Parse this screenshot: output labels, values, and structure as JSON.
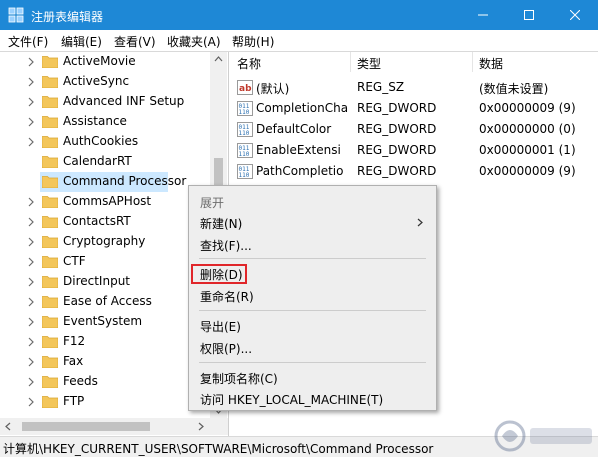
{
  "window": {
    "title": "注册表编辑器"
  },
  "menu": [
    "文件(F)",
    "编辑(E)",
    "查看(V)",
    "收藏夹(A)",
    "帮助(H)"
  ],
  "tree": {
    "selected": "Command Processor",
    "items": [
      "ActiveMovie",
      "ActiveSync",
      "Advanced INF Setup",
      "Assistance",
      "AuthCookies",
      "CalendarRT",
      "Command Processor",
      "CommsAPHost",
      "ContactsRT",
      "Cryptography",
      "CTF",
      "DirectInput",
      "Ease of Access",
      "EventSystem",
      "F12",
      "Fax",
      "Feeds",
      "FTP"
    ]
  },
  "list": {
    "headers": [
      "名称",
      "类型",
      "数据"
    ],
    "rows": [
      {
        "icon": "string-value-icon",
        "name": "(默认)",
        "type": "REG_SZ",
        "data": "(数值未设置)"
      },
      {
        "icon": "binary-value-icon",
        "name": "CompletionChar",
        "type": "REG_DWORD",
        "data": "0x00000009 (9)"
      },
      {
        "icon": "binary-value-icon",
        "name": "DefaultColor",
        "type": "REG_DWORD",
        "data": "0x00000000 (0)"
      },
      {
        "icon": "binary-value-icon",
        "name": "EnableExtensi",
        "type": "REG_DWORD",
        "data": "0x00000001 (1)"
      },
      {
        "icon": "binary-value-icon",
        "name": "PathCompletio",
        "type": "REG_DWORD",
        "data": "0x00000009 (9)"
      }
    ]
  },
  "context_menu": {
    "items": [
      {
        "label": "展开",
        "disabled": true
      },
      {
        "label": "新建(N)",
        "submenu": true
      },
      {
        "label": "查找(F)..."
      },
      {
        "label": "删除(D)",
        "highlighted": true
      },
      {
        "label": "重命名(R)"
      },
      {
        "label": "导出(E)"
      },
      {
        "label": "权限(P)..."
      },
      {
        "label": "复制项名称(C)"
      },
      {
        "label": "访问 HKEY_LOCAL_MACHINE(T)"
      }
    ]
  },
  "status": {
    "path": "计算机\\HKEY_CURRENT_USER\\SOFTWARE\\Microsoft\\Command Processor"
  },
  "colors": {
    "titlebar": "#1e88d6",
    "selection": "#cce8ff",
    "highlight_box": "#e0262a",
    "folder": "#f3c65a"
  }
}
